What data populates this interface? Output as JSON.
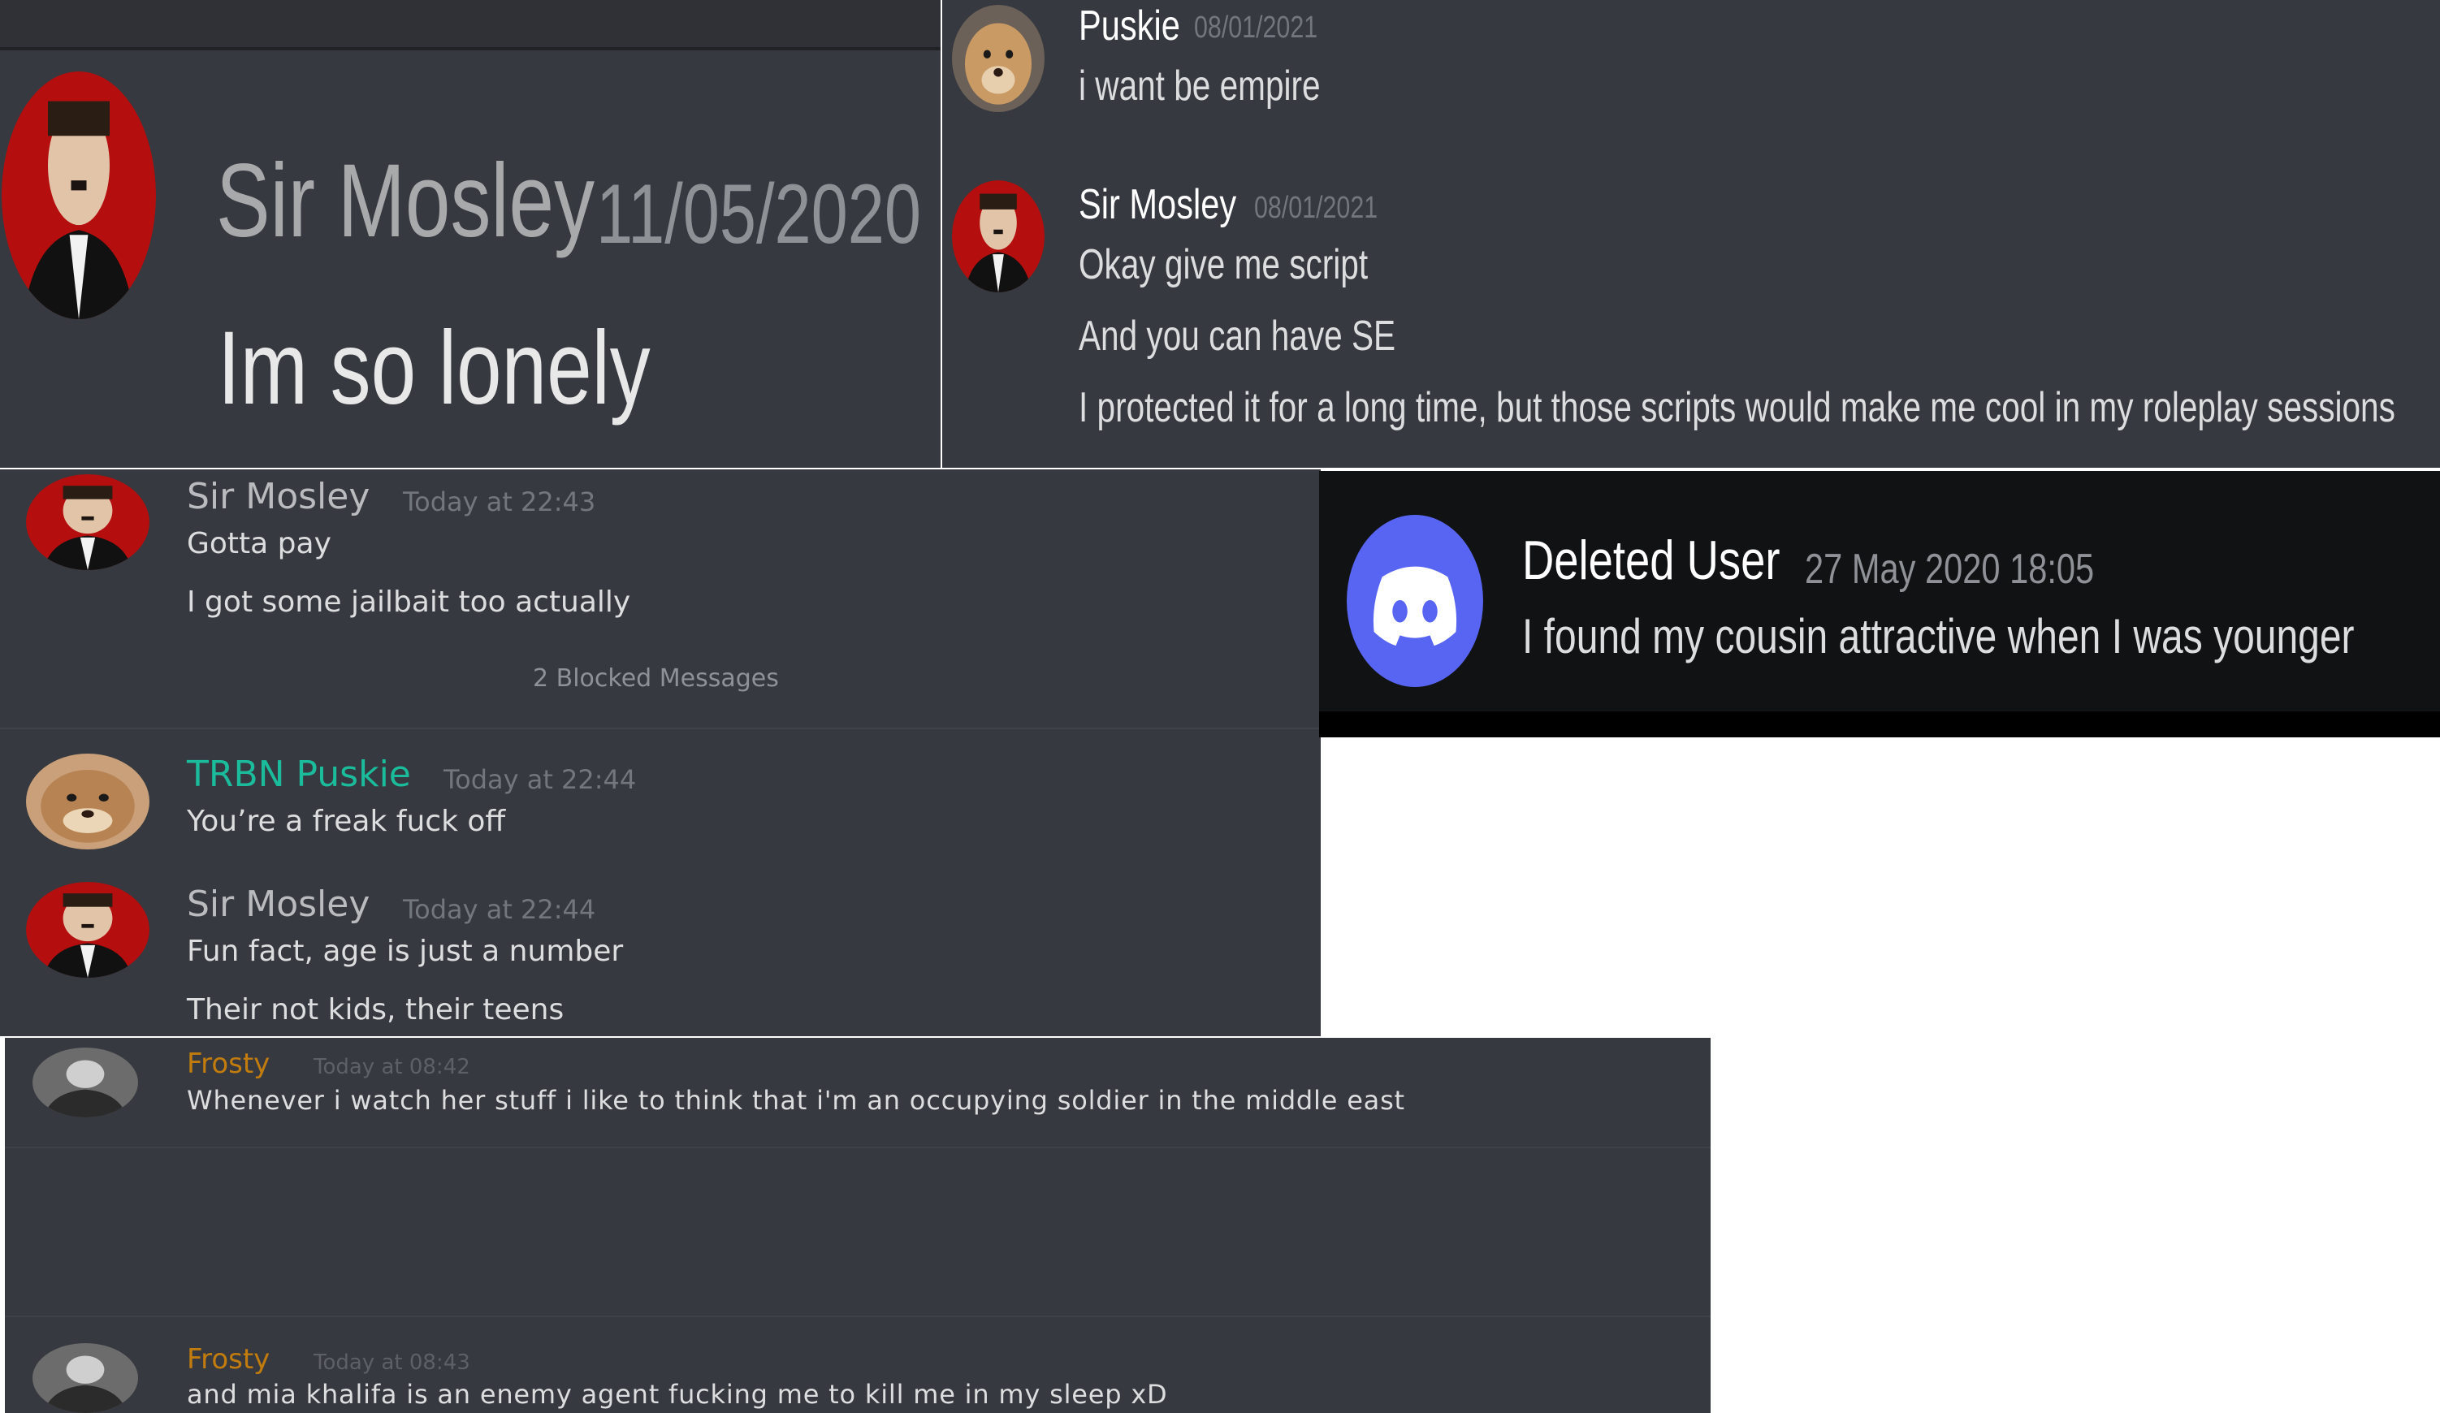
{
  "colors": {
    "background": "#36393f",
    "text": "#dcddde",
    "timestamp": "#72767d",
    "username_default": "#ffffff",
    "username_green": "#1abc9c",
    "username_orange": "#c27c0e",
    "blurple": "#5865f2"
  },
  "p1": {
    "username": "Sir Mosley",
    "timestamp": "11/05/2020",
    "message": "Im so lonely"
  },
  "p2": {
    "m1": {
      "username": "Puskie",
      "timestamp": "08/01/2021",
      "lines": [
        "i want be empire"
      ]
    },
    "m2": {
      "username": "Sir Mosley",
      "timestamp": "08/01/2021",
      "lines": [
        "Okay give me script",
        "And you can have SE",
        "I protected it for a long time, but those scripts would make me cool in my roleplay sessions"
      ]
    }
  },
  "p3": {
    "m1": {
      "username": "Sir Mosley",
      "timestamp": "Today at 22:43",
      "lines": [
        "Gotta pay",
        "I got some jailbait too actually"
      ]
    },
    "blocked": "2 Blocked Messages",
    "m2": {
      "username": "TRBN Puskie",
      "timestamp": "Today at 22:44",
      "lines": [
        "You’re a freak fuck off"
      ]
    },
    "m3": {
      "username": "Sir Mosley",
      "timestamp": "Today at 22:44",
      "lines": [
        "Fun fact, age is just a number",
        "Their not kids, their teens"
      ]
    }
  },
  "p4": {
    "username": "Deleted User",
    "timestamp": "27 May 2020 18:05",
    "message": "I found my cousin attractive when I was younger",
    "avatar_icon": "discord-logo-icon"
  },
  "p5": {
    "m1": {
      "username": "Frosty",
      "timestamp": "Today at 08:42",
      "message": "Whenever i watch her stuff i like to think that i'm an occupying soldier in the middle east"
    },
    "m2": {
      "username": "Frosty",
      "timestamp": "Today at 08:43",
      "message": "and mia khalifa is an enemy agent fucking me to kill me in  my sleep xD"
    }
  }
}
